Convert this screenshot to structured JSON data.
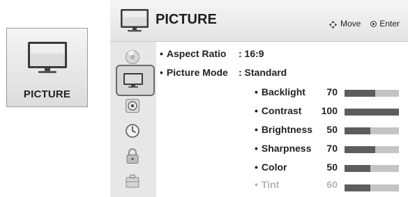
{
  "tile": {
    "label": "PICTURE"
  },
  "header": {
    "title": "PICTURE",
    "hint_move": "Move",
    "hint_enter": "Enter"
  },
  "nav_icons": [
    "disc-icon",
    "tv-icon",
    "speaker-icon",
    "clock-icon",
    "lock-icon",
    "toolbox-icon"
  ],
  "main": {
    "aspect_ratio": {
      "label": "Aspect Ratio",
      "value": ": 16:9"
    },
    "picture_mode": {
      "label": "Picture Mode",
      "value": ": Standard"
    },
    "settings": [
      {
        "label": "Backlight",
        "value": "70",
        "level": 0.57
      },
      {
        "label": "Contrast",
        "value": "100",
        "level": 1.0
      },
      {
        "label": "Brightness",
        "value": "50",
        "level": 0.48
      },
      {
        "label": "Sharpness",
        "value": "70",
        "level": 0.57
      },
      {
        "label": "Color",
        "value": "50",
        "level": 0.48
      },
      {
        "label": "Tint",
        "value": "60",
        "level": 0.48
      }
    ]
  },
  "colors": {
    "bar_fill": "#5d5d5d",
    "bar_track": "#c4c4c4",
    "selection_border": "#6a6a6a"
  }
}
